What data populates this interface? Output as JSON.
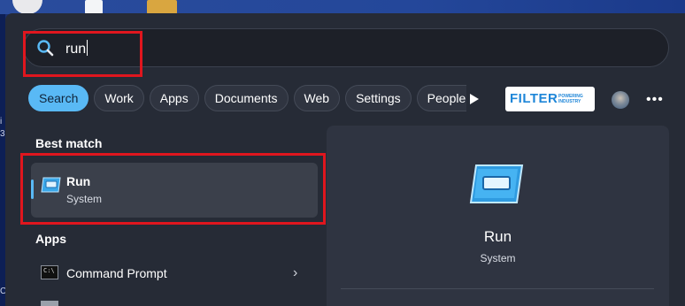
{
  "search": {
    "query": "run"
  },
  "filters": {
    "chips": [
      {
        "label": "Search",
        "active": true
      },
      {
        "label": "Work"
      },
      {
        "label": "Apps"
      },
      {
        "label": "Documents"
      },
      {
        "label": "Web"
      },
      {
        "label": "Settings"
      },
      {
        "label": "People"
      }
    ]
  },
  "logo": {
    "word": "FILTER",
    "tagline": "POWERING INDUSTRY"
  },
  "best_match": {
    "heading": "Best match",
    "item": {
      "title": "Run",
      "subtitle": "System"
    }
  },
  "apps": {
    "heading": "Apps",
    "items": [
      {
        "label": "Command Prompt"
      }
    ]
  },
  "preview": {
    "title": "Run",
    "subtitle": "System"
  },
  "colors": {
    "accent": "#59b9f5",
    "annotation": "#e0161e",
    "panel": "#262b36"
  }
}
